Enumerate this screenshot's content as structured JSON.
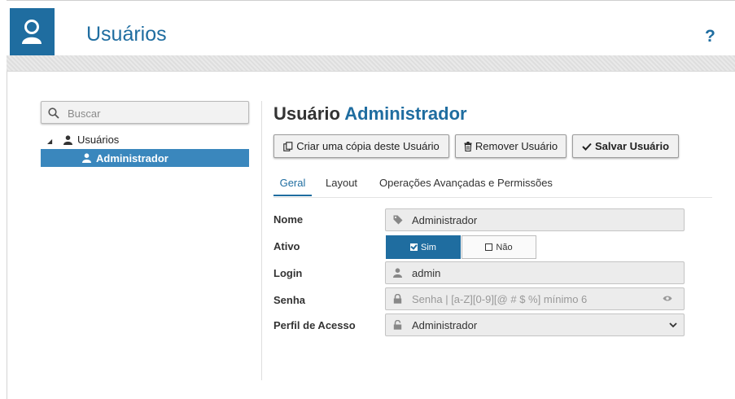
{
  "app": {
    "title": "Usuários",
    "help_label": "?",
    "icon": "user-icon"
  },
  "sidebar": {
    "search_placeholder": "Buscar",
    "tree": {
      "root_label": "Usuários",
      "child_label": "Administrador"
    }
  },
  "main": {
    "heading_prefix": "Usuário",
    "heading_name": "Administrador",
    "buttons": {
      "copy": "Criar uma cópia deste Usuário",
      "remove": "Remover Usuário",
      "save": "Salvar Usuário"
    },
    "tabs": [
      "Geral",
      "Layout",
      "Operações Avançadas e Permissões"
    ],
    "active_tab": "Geral",
    "form": {
      "nome_label": "Nome",
      "nome_value": "Administrador",
      "ativo_label": "Ativo",
      "ativo_yes": "Sim",
      "ativo_no": "Não",
      "ativo_selected": "Sim",
      "login_label": "Login",
      "login_value": "admin",
      "senha_label": "Senha",
      "senha_placeholder": "Senha | [a-Z][0-9][@ # $ %] mínimo 6",
      "perfil_label": "Perfil de Acesso",
      "perfil_value": "Administrador"
    }
  },
  "colors": {
    "accent": "#1f6da0",
    "selection": "#3a87bd"
  }
}
